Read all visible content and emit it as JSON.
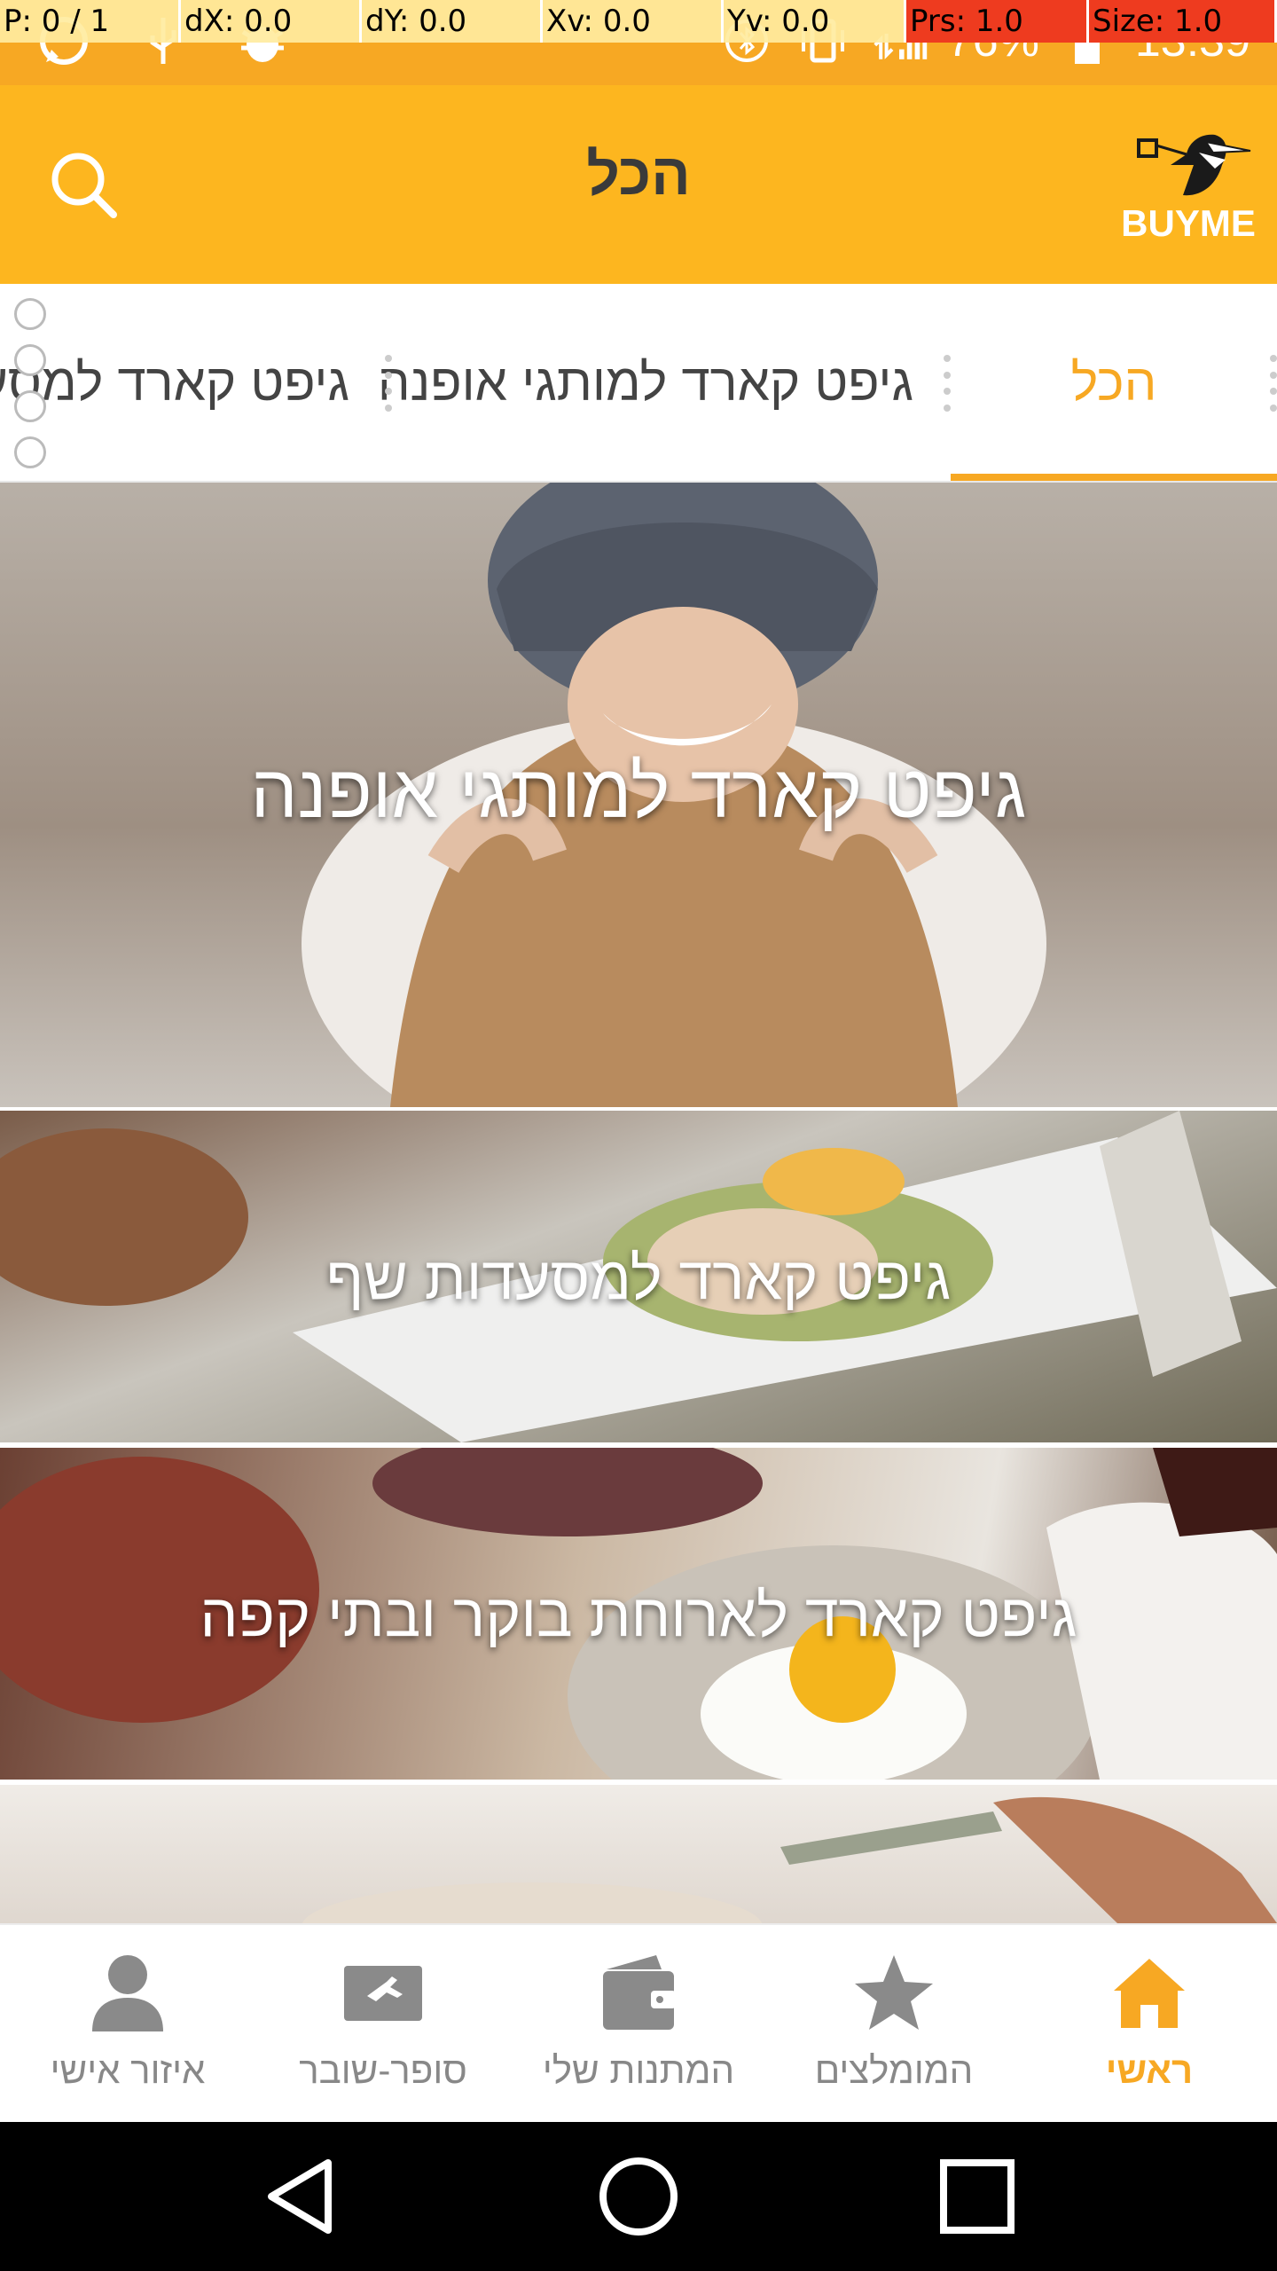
{
  "debug": {
    "pointer": "P: 0 / 1",
    "dx": "dX: 0.0",
    "dy": "dY: 0.0",
    "xv": "Xv: 0.0",
    "yv": "Yv: 0.0",
    "prs": "Prs: 1.0",
    "size": "Size: 1.0"
  },
  "status": {
    "battery": "76%",
    "time": "13:39"
  },
  "header": {
    "title": "הכל",
    "logo_text": "BUYME"
  },
  "tabs": [
    {
      "label": "הכל",
      "active": true
    },
    {
      "label": "גיפט קארד למותגי אופנה",
      "active": false
    },
    {
      "label": "גיפט קארד למסעדות שף",
      "active": false
    }
  ],
  "cards": [
    {
      "title": "גיפט קארד למותגי אופנה"
    },
    {
      "title": "גיפט קארד למסעדות שף"
    },
    {
      "title": "גיפט קארד לארוחת בוקר ובתי קפה"
    },
    {
      "title": ""
    }
  ],
  "bottom_nav": [
    {
      "label": "ראשי",
      "icon": "home-icon",
      "active": true
    },
    {
      "label": "המומלצים",
      "icon": "star-icon",
      "active": false
    },
    {
      "label": "המתנות שלי",
      "icon": "wallet-icon",
      "active": false
    },
    {
      "label": "סופר-שובר",
      "icon": "gift-card-icon",
      "active": false
    },
    {
      "label": "איזור אישי",
      "icon": "person-icon",
      "active": false
    }
  ],
  "colors": {
    "brand": "#fdb61f",
    "accent": "#f7a823"
  }
}
